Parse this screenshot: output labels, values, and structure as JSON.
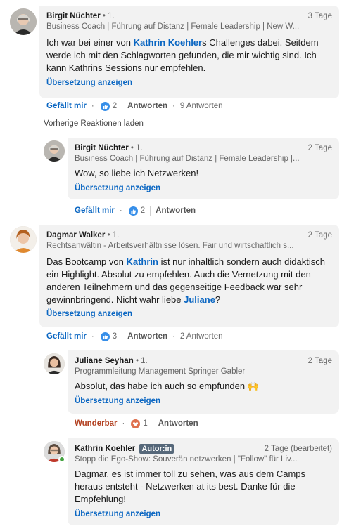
{
  "comments": {
    "c1": {
      "name": "Birgit Nüchter",
      "degree": "• 1.",
      "time": "3 Tage",
      "headline": "Business Coach | Führung auf Distanz | Female Leadership | New W...",
      "body_before": "Ich war bei einer von ",
      "mention": "Kathrin Koehler",
      "body_after": "s Challenges dabei. Seitdem werde ich mit den Schlagworten gefunden, die mir wichtig sind. Ich kann Kathrins Sessions nur empfehlen.",
      "translate": "Übersetzung anzeigen",
      "like_label": "Gefällt mir",
      "reaction_count": "2",
      "reply_label": "Antworten",
      "replies_count": "9 Antworten"
    },
    "prev_label": "Vorherige Reaktionen laden",
    "r1": {
      "name": "Birgit Nüchter",
      "degree": "• 1.",
      "time": "2 Tage",
      "headline": "Business Coach | Führung auf Distanz | Female Leadership |...",
      "body": "Wow, so liebe ich Netzwerken!",
      "translate": "Übersetzung anzeigen",
      "like_label": "Gefällt mir",
      "reaction_count": "2",
      "reply_label": "Antworten"
    },
    "c2": {
      "name": "Dagmar Walker",
      "degree": "• 1.",
      "time": "2 Tage",
      "headline": "Rechtsanwältin - Arbeitsverhältnisse lösen. Fair und wirtschaftlich s...",
      "body_1": "Das Bootcamp von ",
      "mention_1": "Kathrin",
      "body_2": " ist nur inhaltlich sondern auch didaktisch ein Highlight. Absolut zu empfehlen. Auch die Vernetzung mit den anderen Teilnehmern und das gegenseitige Feedback war sehr gewinnbringend. Nicht wahr liebe ",
      "mention_2": "Juliane",
      "body_3": "?",
      "translate": "Übersetzung anzeigen",
      "like_label": "Gefällt mir",
      "reaction_count": "3",
      "reply_label": "Antworten",
      "replies_count": "2 Antworten"
    },
    "r2": {
      "name": "Juliane Seyhan",
      "degree": "• 1.",
      "time": "2 Tage",
      "headline": "Programmleitung Management Springer Gabler",
      "body": "Absolut, das habe ich auch so empfunden 🙌",
      "translate": "Übersetzung anzeigen",
      "like_label": "Wunderbar",
      "reaction_count": "1",
      "reply_label": "Antworten"
    },
    "r3": {
      "name": "Kathrin Koehler",
      "badge": "Autor:in",
      "time": "2 Tage (bearbeitet)",
      "headline": "Stopp die Ego-Show: Souverän netzwerken | \"Follow\" für Liv...",
      "body": "Dagmar, es ist immer toll zu sehen, was aus dem Camps heraus entsteht - Netzwerken at its best. Danke für die Empfehlung!",
      "translate": "Übersetzung anzeigen"
    }
  },
  "colors": {
    "link": "#0a66c2",
    "bubble": "#f2f2f2",
    "celebrate": "#b24020",
    "badge": "#56687a"
  }
}
